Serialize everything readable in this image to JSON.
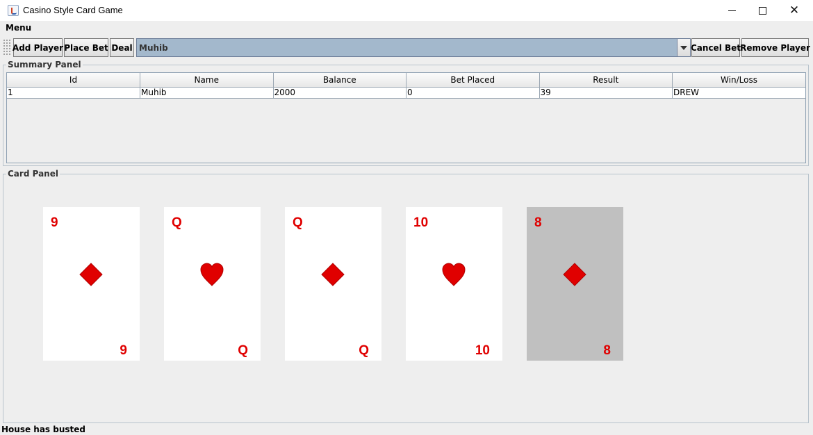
{
  "window": {
    "title": "Casino Style Card Game"
  },
  "menubar": {
    "items": [
      {
        "label": "Menu"
      }
    ]
  },
  "toolbar": {
    "add_player": "Add Player",
    "place_bet": "Place Bet",
    "deal": "Deal",
    "player_select": {
      "value": "Muhib"
    },
    "cancel_bet": "Cancel Bet",
    "remove_player": "Remove Player"
  },
  "summary": {
    "title": "Summary Panel",
    "columns": [
      "Id",
      "Name",
      "Balance",
      "Bet Placed",
      "Result",
      "Win/Loss"
    ],
    "rows": [
      [
        "1",
        "Muhib",
        "2000",
        "0",
        "39",
        "DREW"
      ]
    ]
  },
  "card_panel": {
    "title": "Card Panel",
    "cards": [
      {
        "rank": "9",
        "suit": "diamond-icon",
        "highlighted": false
      },
      {
        "rank": "Q",
        "suit": "heart-icon",
        "highlighted": false
      },
      {
        "rank": "Q",
        "suit": "diamond-icon",
        "highlighted": false
      },
      {
        "rank": "10",
        "suit": "heart-icon",
        "highlighted": false
      },
      {
        "rank": "8",
        "suit": "diamond-icon",
        "highlighted": true
      }
    ],
    "suit_color": "#e00000"
  },
  "status": {
    "text": "House has busted"
  }
}
